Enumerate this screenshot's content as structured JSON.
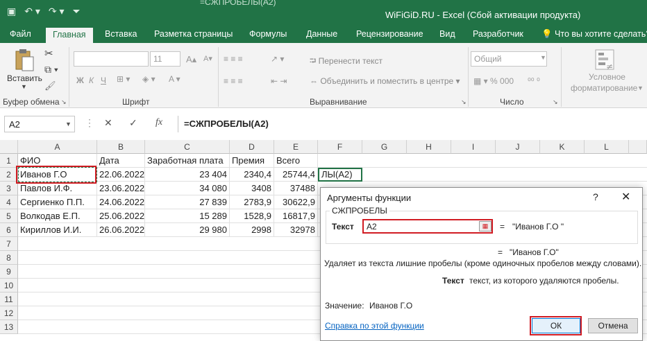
{
  "window": {
    "title": "WiFiGiD.RU - Excel (Сбой активации продукта)",
    "formula_ghost": "=СЖПРОБЕЛЫ(A2)"
  },
  "tabs": [
    "Файл",
    "Главная",
    "Вставка",
    "Разметка страницы",
    "Формулы",
    "Данные",
    "Рецензирование",
    "Вид",
    "Разработчик"
  ],
  "tell_me": "Что вы хотите сделать?",
  "ribbon": {
    "paste": "Вставить",
    "clipboard": "Буфер обмена",
    "font": "Шрифт",
    "font_size": "11",
    "bold": "Ж",
    "italic": "К",
    "underline": "Ч",
    "wrap": "Перенести текст",
    "merge": "Объединить и поместить в центре",
    "align": "Выравнивание",
    "number_format": "Общий",
    "number": "Число",
    "cond1": "Условное",
    "cond2": "форматирование"
  },
  "formula_bar": {
    "name_box": "A2",
    "cancel": "✕",
    "enter": "✓",
    "fx": "fx",
    "formula": "=СЖПРОБЕЛЫ(A2)"
  },
  "columns": [
    "A",
    "B",
    "C",
    "D",
    "E",
    "F",
    "G",
    "H",
    "I",
    "J",
    "K",
    "L"
  ],
  "rows": [
    "1",
    "2",
    "3",
    "4",
    "5",
    "6",
    "7",
    "8",
    "9",
    "10",
    "11",
    "12",
    "13"
  ],
  "table": {
    "headers": [
      "ФИО",
      "Дата",
      "Заработная плата",
      "Премия",
      "Всего"
    ],
    "data": [
      [
        "Иванов Г.О",
        "22.06.2022",
        "23 404",
        "2340,4",
        "25744,4"
      ],
      [
        "Павлов И.Ф.",
        "23.06.2022",
        "34 080",
        "3408",
        "37488"
      ],
      [
        "Сергиенко П.П.",
        "24.06.2022",
        "27 839",
        "2783,9",
        "30622,9"
      ],
      [
        "Волкодав Е.П.",
        "25.06.2022",
        "15 289",
        "1528,9",
        "16817,9"
      ],
      [
        "Кириллов И.И.",
        "26.06.2022",
        "29 980",
        "2998",
        "32978"
      ]
    ],
    "f2": "ЛЫ(A2)"
  },
  "dialog": {
    "title": "Аргументы функции",
    "help_mark": "?",
    "close": "✕",
    "function": "СЖПРОБЕЛЫ",
    "arg_label": "Текст",
    "arg_value": "A2",
    "arg_result": "\"Иванов Г.О \"",
    "result": "\"Иванов Г.О\"",
    "equals": "=",
    "description": "Удаляет из текста лишние пробелы (кроме одиночных пробелов между словами).",
    "arg_name": "Текст",
    "arg_desc": "текст, из которого удаляются пробелы.",
    "value_label": "Значение:",
    "value": "Иванов Г.О",
    "help_link": "Справка по этой функции",
    "ok": "ОК",
    "cancel": "Отмена"
  },
  "colors": {
    "excel_green": "#217346",
    "highlight_red": "#d11b22",
    "link_blue": "#0563c1"
  }
}
